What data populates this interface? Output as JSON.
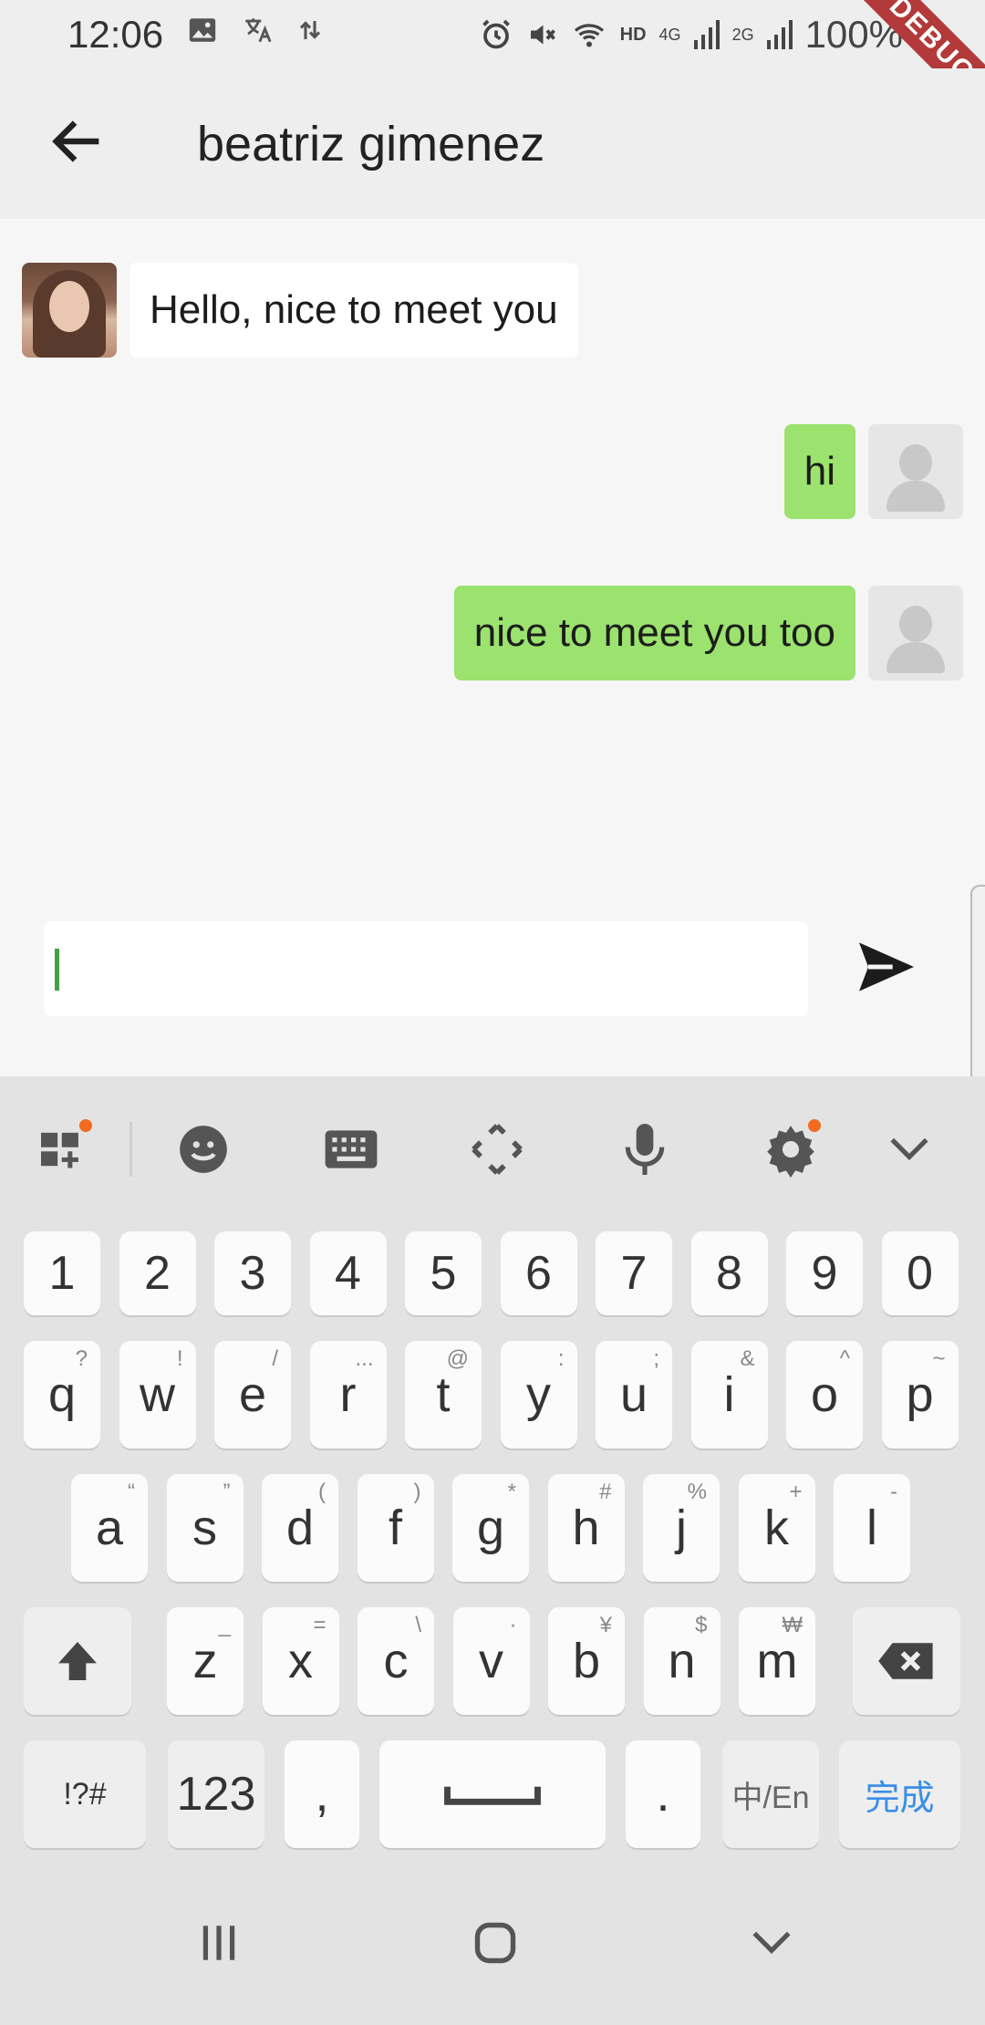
{
  "status_bar": {
    "time": "12:06",
    "battery": "100%",
    "network": "4G",
    "network2": "2G",
    "hd": "HD",
    "debug_label": "DEBUG"
  },
  "app_bar": {
    "title": "beatriz gimenez"
  },
  "messages": [
    {
      "sender": "other",
      "text": "Hello, nice to meet you"
    },
    {
      "sender": "me",
      "text": "hi"
    },
    {
      "sender": "me",
      "text": "nice to meet you too"
    }
  ],
  "composer": {
    "value": "",
    "placeholder": ""
  },
  "keyboard": {
    "number_row": [
      "1",
      "2",
      "3",
      "4",
      "5",
      "6",
      "7",
      "8",
      "9",
      "0"
    ],
    "row1": [
      {
        "key": "q",
        "hint": "?"
      },
      {
        "key": "w",
        "hint": "!"
      },
      {
        "key": "e",
        "hint": "/"
      },
      {
        "key": "r",
        "hint": "..."
      },
      {
        "key": "t",
        "hint": "@"
      },
      {
        "key": "y",
        "hint": ":"
      },
      {
        "key": "u",
        "hint": ";"
      },
      {
        "key": "i",
        "hint": "&"
      },
      {
        "key": "o",
        "hint": "^"
      },
      {
        "key": "p",
        "hint": "~"
      }
    ],
    "row2": [
      {
        "key": "a",
        "hint": "“"
      },
      {
        "key": "s",
        "hint": "”"
      },
      {
        "key": "d",
        "hint": "("
      },
      {
        "key": "f",
        "hint": ")"
      },
      {
        "key": "g",
        "hint": "*"
      },
      {
        "key": "h",
        "hint": "#"
      },
      {
        "key": "j",
        "hint": "%"
      },
      {
        "key": "k",
        "hint": "+"
      },
      {
        "key": "l",
        "hint": "-"
      }
    ],
    "row3": [
      {
        "key": "z",
        "hint": "_"
      },
      {
        "key": "x",
        "hint": "="
      },
      {
        "key": "c",
        "hint": "\\"
      },
      {
        "key": "v",
        "hint": "·"
      },
      {
        "key": "b",
        "hint": "¥"
      },
      {
        "key": "n",
        "hint": "$"
      },
      {
        "key": "m",
        "hint": "₩"
      }
    ],
    "symbols_label": "!?#",
    "numbers_label": "123",
    "comma": ",",
    "period": ".",
    "lang_label": "中/En",
    "done_label": "完成"
  }
}
